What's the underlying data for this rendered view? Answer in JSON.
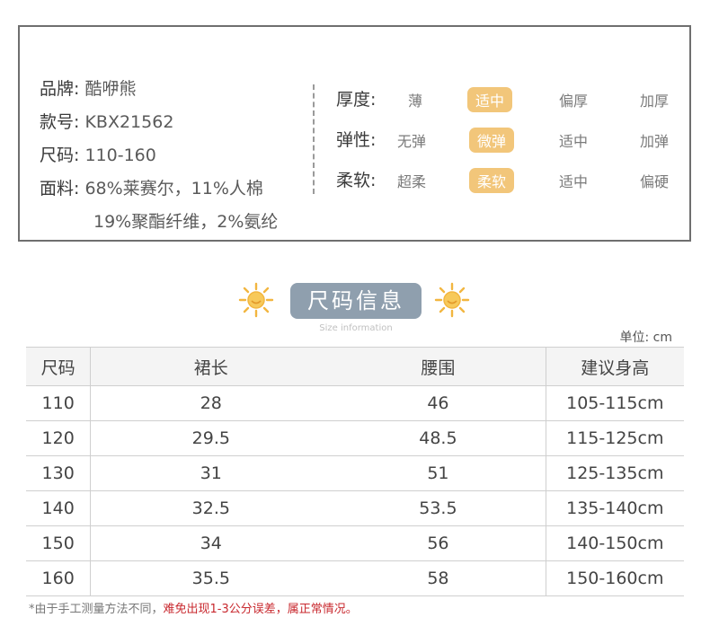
{
  "product": {
    "brand_label": "品牌:",
    "brand_value": "酷咿熊",
    "model_label": "款号:",
    "model_value": "KBX21562",
    "size_label": "尺码:",
    "size_value": "110-160",
    "fabric_label": "面料:",
    "fabric_line1": "68%莱赛尔，11%人棉",
    "fabric_line2": "19%聚酯纤维，2%氨纶"
  },
  "attributes": [
    {
      "label": "厚度:",
      "options": [
        "薄",
        "适中",
        "偏厚",
        "加厚"
      ],
      "selected": "适中"
    },
    {
      "label": "弹性:",
      "options": [
        "无弹",
        "微弹",
        "适中",
        "加弹"
      ],
      "selected": "微弹"
    },
    {
      "label": "柔软:",
      "options": [
        "超柔",
        "柔软",
        "适中",
        "偏硬"
      ],
      "selected": "柔软"
    }
  ],
  "section": {
    "title": "尺码信息",
    "subtitle": "Size information",
    "unit": "单位: cm"
  },
  "table": {
    "headers": [
      "尺码",
      "裙长",
      "腰围",
      "建议身高"
    ],
    "rows": [
      [
        "110",
        "28",
        "46",
        "105-115cm"
      ],
      [
        "120",
        "29.5",
        "48.5",
        "115-125cm"
      ],
      [
        "130",
        "31",
        "51",
        "125-135cm"
      ],
      [
        "140",
        "32.5",
        "53.5",
        "135-140cm"
      ],
      [
        "150",
        "34",
        "56",
        "140-150cm"
      ],
      [
        "160",
        "35.5",
        "58",
        "150-160cm"
      ]
    ]
  },
  "note": {
    "gray": "*由于手工测量方法不同，",
    "red": "难免出现1-3公分误差，属正常情况。"
  },
  "colors": {
    "selected_badge": "#f2c67a",
    "title_pill": "#8f9fae",
    "note_red": "#c8282e",
    "sun": "#f2b640"
  },
  "icons": {
    "decor_left": "sun-icon",
    "decor_right": "sun-icon"
  }
}
